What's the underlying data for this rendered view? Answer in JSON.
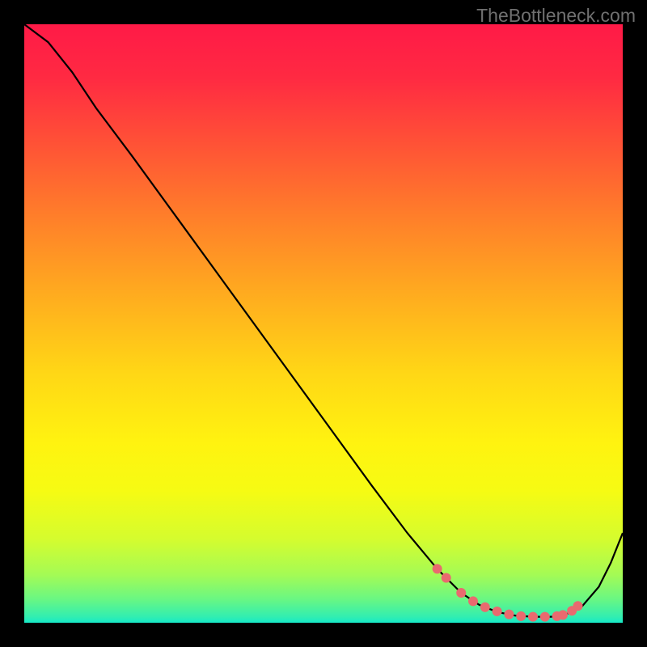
{
  "watermark": "TheBottleneck.com",
  "chart_data": {
    "type": "line",
    "title": "",
    "xlabel": "",
    "ylabel": "",
    "xlim": [
      0,
      100
    ],
    "ylim": [
      0,
      100
    ],
    "gradient_stops": [
      {
        "offset": 0.0,
        "color": "#ff1a47"
      },
      {
        "offset": 0.09,
        "color": "#ff2a42"
      },
      {
        "offset": 0.2,
        "color": "#ff5236"
      },
      {
        "offset": 0.32,
        "color": "#ff7e2a"
      },
      {
        "offset": 0.45,
        "color": "#ffab1f"
      },
      {
        "offset": 0.58,
        "color": "#ffd616"
      },
      {
        "offset": 0.7,
        "color": "#fff310"
      },
      {
        "offset": 0.78,
        "color": "#f6fb13"
      },
      {
        "offset": 0.86,
        "color": "#d5fc2e"
      },
      {
        "offset": 0.92,
        "color": "#a4fb55"
      },
      {
        "offset": 0.96,
        "color": "#6af782"
      },
      {
        "offset": 0.99,
        "color": "#32eeb0"
      },
      {
        "offset": 1.0,
        "color": "#16e9c8"
      }
    ],
    "series": [
      {
        "name": "curve",
        "x": [
          0,
          4,
          8,
          12,
          18,
          26,
          34,
          42,
          50,
          58,
          64,
          69,
          73,
          76,
          79,
          82,
          85,
          88,
          90,
          93,
          96,
          98,
          100
        ],
        "y": [
          100,
          97,
          92,
          86,
          78,
          67,
          56,
          45,
          34,
          23,
          15,
          9,
          5,
          3,
          1.8,
          1.2,
          1.0,
          1.0,
          1.2,
          2.5,
          6,
          10,
          15
        ]
      }
    ],
    "markers": {
      "name": "dots",
      "x": [
        69,
        70.5,
        73,
        75,
        77,
        79,
        81,
        83,
        85,
        87,
        89,
        90,
        91.5,
        92.5
      ],
      "y": [
        9,
        7.5,
        5,
        3.6,
        2.6,
        1.9,
        1.4,
        1.1,
        1.0,
        1.0,
        1.1,
        1.3,
        2.0,
        2.8
      ],
      "color": "#e96a6f",
      "radius": 6
    }
  }
}
